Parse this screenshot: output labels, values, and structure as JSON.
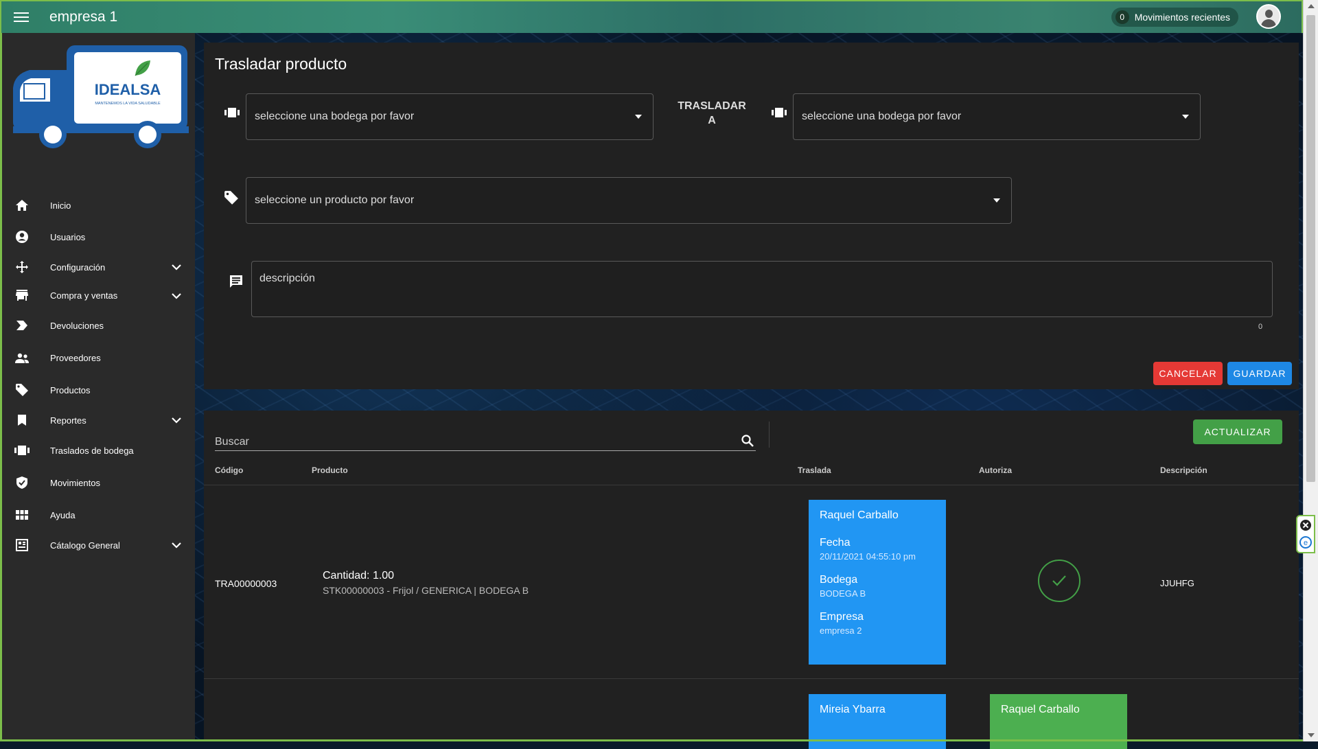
{
  "topbar": {
    "title": "empresa 1",
    "recent_count": "0",
    "recent_label": "Movimientos recientes"
  },
  "logo": {
    "brand": "IDEALSA",
    "tagline": "MANTENEMOS LA VIDA SALUDABLE"
  },
  "sidebar": {
    "items": [
      {
        "label": "Inicio",
        "icon": "home-icon"
      },
      {
        "label": "Usuarios",
        "icon": "account-circle-icon"
      },
      {
        "label": "Configuración",
        "icon": "move-arrows-icon",
        "expandable": true
      },
      {
        "label": "Compra y ventas",
        "icon": "store-icon",
        "expandable": true
      },
      {
        "label": "Devoluciones",
        "icon": "label-arrow-icon"
      },
      {
        "label": "Proveedores",
        "icon": "people-icon"
      },
      {
        "label": "Productos",
        "icon": "tag-icon"
      },
      {
        "label": "Reportes",
        "icon": "bookmark-icon",
        "expandable": true
      },
      {
        "label": "Traslados de bodega",
        "icon": "transfer-icon"
      },
      {
        "label": "Movimientos",
        "icon": "shield-check-icon"
      },
      {
        "label": "Ayuda",
        "icon": "grid-icon"
      },
      {
        "label": "Cátalogo General",
        "icon": "catalog-icon",
        "expandable": true
      }
    ]
  },
  "form": {
    "title": "Trasladar producto",
    "bodega_origen_placeholder": "seleccione una bodega por favor",
    "trasladar_label_1": "TRASLADAR",
    "trasladar_label_2": "A",
    "bodega_destino_placeholder": "seleccione una bodega por favor",
    "producto_placeholder": "seleccione un producto por favor",
    "descripcion_placeholder": "descripción",
    "char_count": "0",
    "cancel_label": "Cancelar",
    "save_label": "Guardar"
  },
  "table": {
    "search_placeholder": "Buscar",
    "refresh_label": "Actualizar",
    "headers": [
      "Código",
      "Producto",
      "Traslada",
      "Autoriza",
      "Descripción"
    ],
    "rows": [
      {
        "code": "TRA00000003",
        "qty": "Cantidad: 1.00",
        "product": "STK00000003 - Frijol / GENERICA | BODEGA B",
        "traslada": {
          "name": "Raquel Carballo",
          "fecha_label": "Fecha",
          "fecha": "20/11/2021 04:55:10 pm",
          "bodega_label": "Bodega",
          "bodega": "BODEGA B",
          "empresa_label": "Empresa",
          "empresa": "empresa 2"
        },
        "autoriza_status": "check-icon",
        "description": "JJUHFG"
      },
      {
        "traslada": {
          "name": "Mireia Ybarra"
        },
        "autoriza": {
          "name": "Raquel Carballo"
        }
      }
    ]
  },
  "colors": {
    "accent_green": "#7cbe4a",
    "cancel": "#e53935",
    "save": "#1e88e5",
    "refresh": "#43a047",
    "card_blue": "#2196f3",
    "card_green": "#4caf50"
  }
}
